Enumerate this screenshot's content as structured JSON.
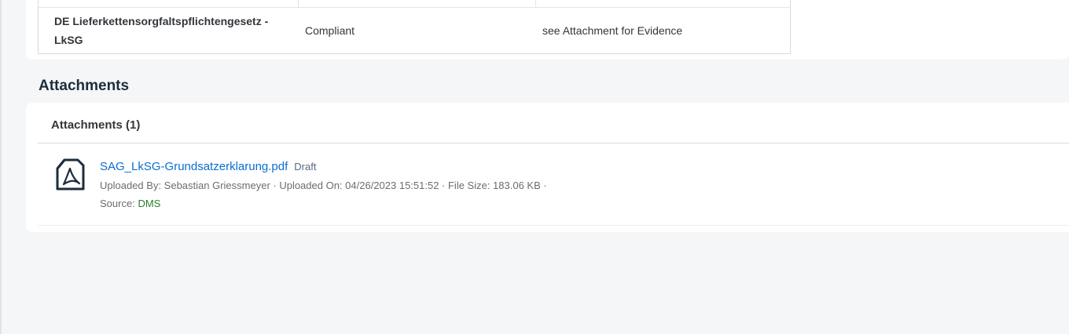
{
  "compliance_table": {
    "row": {
      "regulation": "DE Lieferkettensorgfaltspflichtengesetz - LkSG",
      "status": "Compliant",
      "comment": "see Attachment for Evidence"
    }
  },
  "attachments_section": {
    "title": "Attachments",
    "header": "Attachments (1)",
    "items": [
      {
        "icon": "pdf-file-icon",
        "file_name": "SAG_LkSG-Grundsatzerklarung.pdf",
        "state": "Draft",
        "meta_line": "Uploaded By: Sebastian Griessmeyer · Uploaded On: 04/26/2023 15:51:52 · File Size: 183.06 KB ·",
        "source_label": "Source:",
        "source_value": "DMS"
      }
    ]
  },
  "colors": {
    "link": "#0a6ed1",
    "source_value": "#2b7d2b",
    "background": "#f5f6f7"
  }
}
